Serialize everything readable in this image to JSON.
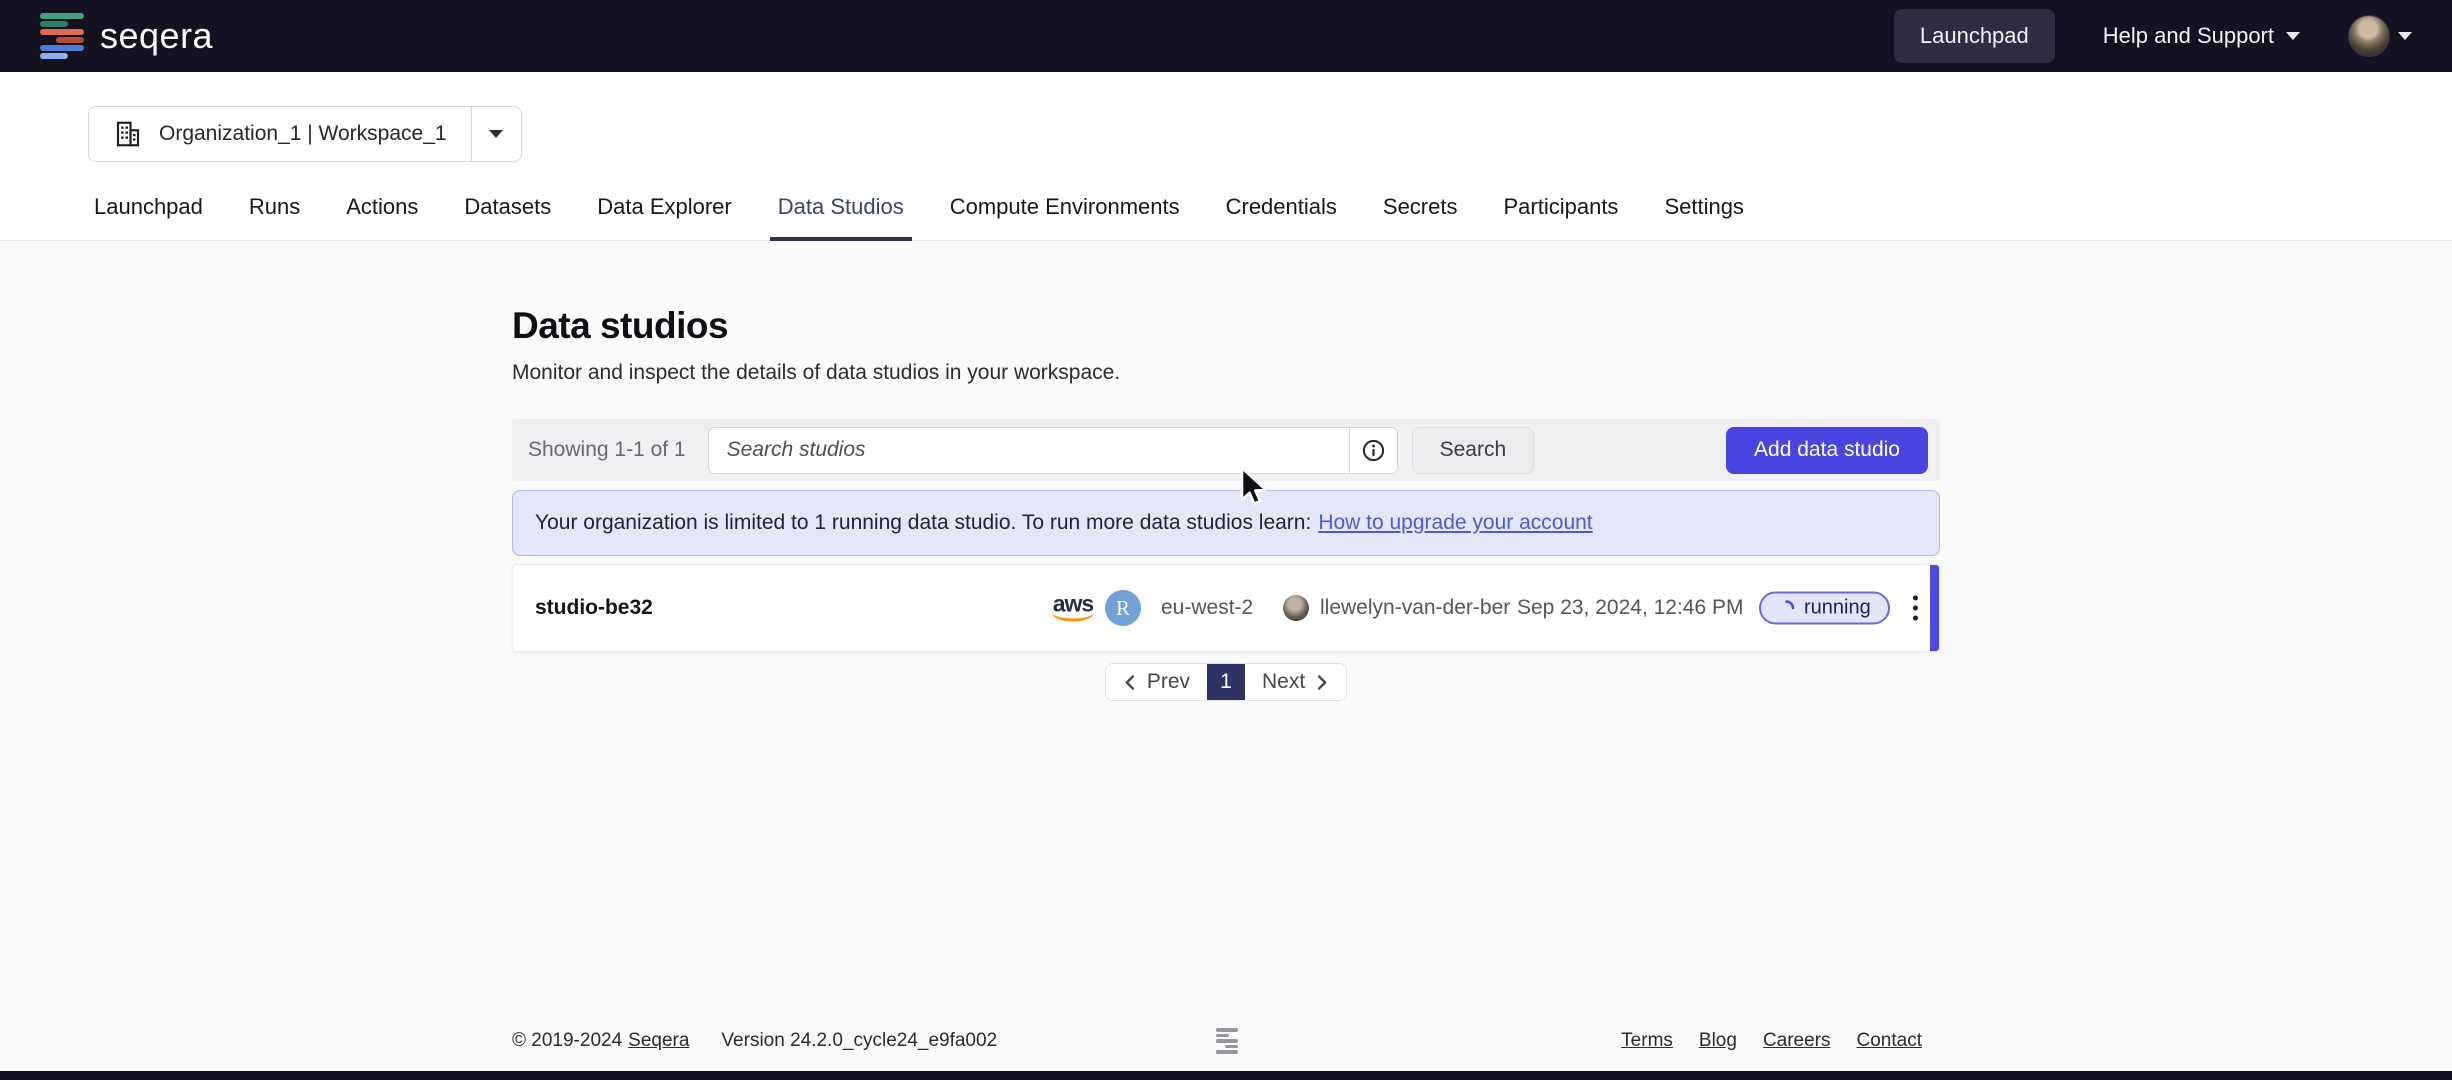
{
  "colors": {
    "navbar_bg": "#141220",
    "accent_button": "#4945e0",
    "active_tab": "#3b4368",
    "banner_bg": "#e4e7f8",
    "banner_border": "#b0b9ea",
    "link": "#4a5cd0",
    "status_border": "#666bd8",
    "status_bg": "#e3e5fb",
    "pagination_active_bg": "#2c3262",
    "row_accent": "#4f4ae0"
  },
  "navbar": {
    "logo_text": "seqera",
    "launchpad_label": "Launchpad",
    "help_label": "Help and Support"
  },
  "workspace_selector": {
    "label": "Organization_1 | Workspace_1"
  },
  "tabs": [
    {
      "label": "Launchpad"
    },
    {
      "label": "Runs"
    },
    {
      "label": "Actions"
    },
    {
      "label": "Datasets"
    },
    {
      "label": "Data Explorer"
    },
    {
      "label": "Data Studios",
      "active": true
    },
    {
      "label": "Compute Environments"
    },
    {
      "label": "Credentials"
    },
    {
      "label": "Secrets"
    },
    {
      "label": "Participants"
    },
    {
      "label": "Settings"
    }
  ],
  "page": {
    "title": "Data studios",
    "subtitle": "Monitor and inspect the details of data studios in your workspace."
  },
  "toolbar": {
    "showing": "Showing 1-1 of 1",
    "search_placeholder": "Search studios",
    "search_button": "Search",
    "add_button": "Add data studio"
  },
  "banner": {
    "text": "Your organization is limited to 1 running data studio. To run more data studios learn:",
    "link_text": "How to upgrade your account"
  },
  "studio_row": {
    "name": "studio-be32",
    "provider": "aws",
    "app_badge": "R",
    "region": "eu-west-2",
    "user": "llewelyn-van-der-ber",
    "created": "Sep 23, 2024, 12:46 PM",
    "status": "running"
  },
  "pagination": {
    "prev": "Prev",
    "current_page": "1",
    "next": "Next"
  },
  "footer": {
    "copyright": "© 2019-2024",
    "copyright_link": "Seqera",
    "version": "Version 24.2.0_cycle24_e9fa002",
    "links": [
      {
        "label": "Terms"
      },
      {
        "label": "Blog"
      },
      {
        "label": "Careers"
      },
      {
        "label": "Contact"
      }
    ]
  }
}
